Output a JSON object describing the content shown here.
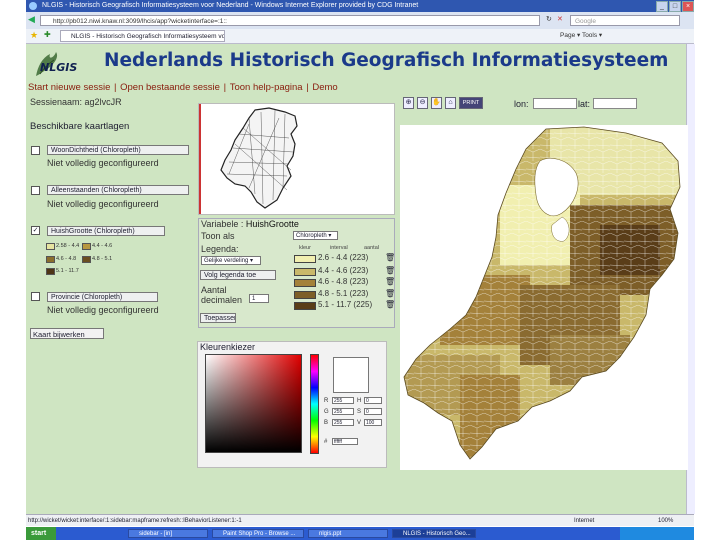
{
  "window": {
    "title": "NLGIS - Historisch Geografisch Informatiesysteem voor Nederland - Windows Internet Explorer provided by CDG Intranet",
    "url": "http://pb012.niwi.knaw.nl:3099/lhcis/app?wicketinterface=:1::",
    "search_placeholder": "Google",
    "tab_title": "NLGIS - Historisch Geografisch Informatiesysteem voo...",
    "commands": "Page ▾  Tools ▾"
  },
  "header": {
    "logo_text": "NLGIS",
    "title": "Nederlands Historisch Geografisch Informatiesysteem"
  },
  "nav": [
    "Start nieuwe sessie",
    "Open bestaande sessie",
    "Toon help-pagina",
    "Demo"
  ],
  "session": {
    "label": "Sessienaam",
    "value": "ag2lvcJR"
  },
  "coords": {
    "lon_label": "lon:",
    "lat_label": "lat:"
  },
  "tools": [
    "⊕",
    "⊖",
    "✋",
    "⌂",
    "PRINT"
  ],
  "layers": {
    "title": "Beschikbare kaartlagen",
    "items": [
      {
        "checked": false,
        "name": "WoonDichtheid (Chloropleth)",
        "note": "Niet volledig geconfigureerd"
      },
      {
        "checked": false,
        "name": "Alleenstaanden (Chloropleth)",
        "note": "Niet volledig geconfigureerd"
      },
      {
        "checked": true,
        "name": "HuishGrootte (Chloropleth)",
        "note": ""
      },
      {
        "checked": false,
        "name": "Provincie (Chloropleth)",
        "note": "Niet volledig geconfigureerd"
      }
    ],
    "mini_legend": [
      {
        "text": "2.58 - 4.4",
        "color": "#e6e4a0"
      },
      {
        "text": "4.4 - 4.6",
        "color": "#b8973f"
      },
      {
        "text": "4.6 - 4.8",
        "color": "#8a6e2c"
      },
      {
        "text": "4.8 - 5.1",
        "color": "#6b4e20"
      },
      {
        "text": "5.1 - 11.7",
        "color": "#4e3516"
      }
    ],
    "kaart_button": "Kaart bijwerken"
  },
  "variable_panel": {
    "variable_label": "Variabele :",
    "variable_value": "HuishGrootte",
    "toon_als_label": "Toon als",
    "toon_als_value": "Chloropleth",
    "legenda_label": "Legenda:",
    "legenda_value": "Gelijke verdeling",
    "legenda_button": "Volg legenda toe",
    "aantal_label": "Aantal decimalen",
    "aantal_value": "1",
    "apply_button": "Toepassen",
    "col_kleur": "kleur",
    "col_interval": "interval",
    "col_aantal": "aantal",
    "classes": [
      {
        "text": "2.6 - 4.4 (223)",
        "color": "#f1efb0"
      },
      {
        "text": "4.4 - 4.6 (223)",
        "color": "#c9b86a"
      },
      {
        "text": "4.6 - 4.8 (223)",
        "color": "#a4813a"
      },
      {
        "text": "4.8 - 5.1 (223)",
        "color": "#7d5e28"
      },
      {
        "text": "5.1 - 11.7 (225)",
        "color": "#5a3d18"
      }
    ]
  },
  "color_picker": {
    "title": "Kleurenkiezer",
    "fields": [
      {
        "label": "R",
        "value": "255"
      },
      {
        "label": "G",
        "value": "255"
      },
      {
        "label": "B",
        "value": "255"
      },
      {
        "label": "H",
        "value": "0"
      },
      {
        "label": "S",
        "value": "0"
      },
      {
        "label": "V",
        "value": "100"
      }
    ],
    "hex_label": "#",
    "hex_value": "ffffff"
  },
  "status_bar": {
    "text": "http://wicket/wicket:interface/:1:sidebar:mapframe:refresh::IBehaviorListener:1:-1",
    "zone": "Internet",
    "zoom": "100%"
  },
  "taskbar": {
    "start": "start",
    "tasks": [
      "sidebar - [in]",
      "Paint Shop Pro - Browse ...",
      "nlgis.ppt",
      "NLGIS - Historisch Geo..."
    ]
  }
}
